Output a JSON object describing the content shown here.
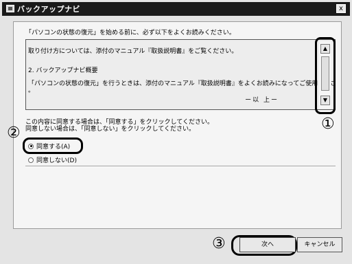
{
  "window": {
    "title": "バックアップナビ",
    "close_label": "x"
  },
  "intro_text": "「パソコンの状態の復元」を始める前に、必ず以下をよくお読みください。",
  "license": {
    "lines": [
      "取り付け方については、添付のマニュアル『取扱説明書』をご覧ください。",
      "2. バックアップナビ概要",
      "「パソコンの状態の復元」を行うときは、添付のマニュアル『取扱説明書』をよくお読みになってご使用ください",
      "。"
    ],
    "end_marker": "ー以 上ー"
  },
  "agreement": {
    "line1": "この内容に同意する場合は、「同意する」をクリックしてください。",
    "line2": "同意しない場合は、「同意しない」をクリックしてください。",
    "agree_label": "同意する(A)",
    "disagree_label": "同意しない(D)",
    "selected": "agree"
  },
  "buttons": {
    "next_label": "次へ",
    "cancel_label": "キャンセル"
  },
  "callouts": {
    "one": "①",
    "two": "②",
    "three": "③"
  }
}
